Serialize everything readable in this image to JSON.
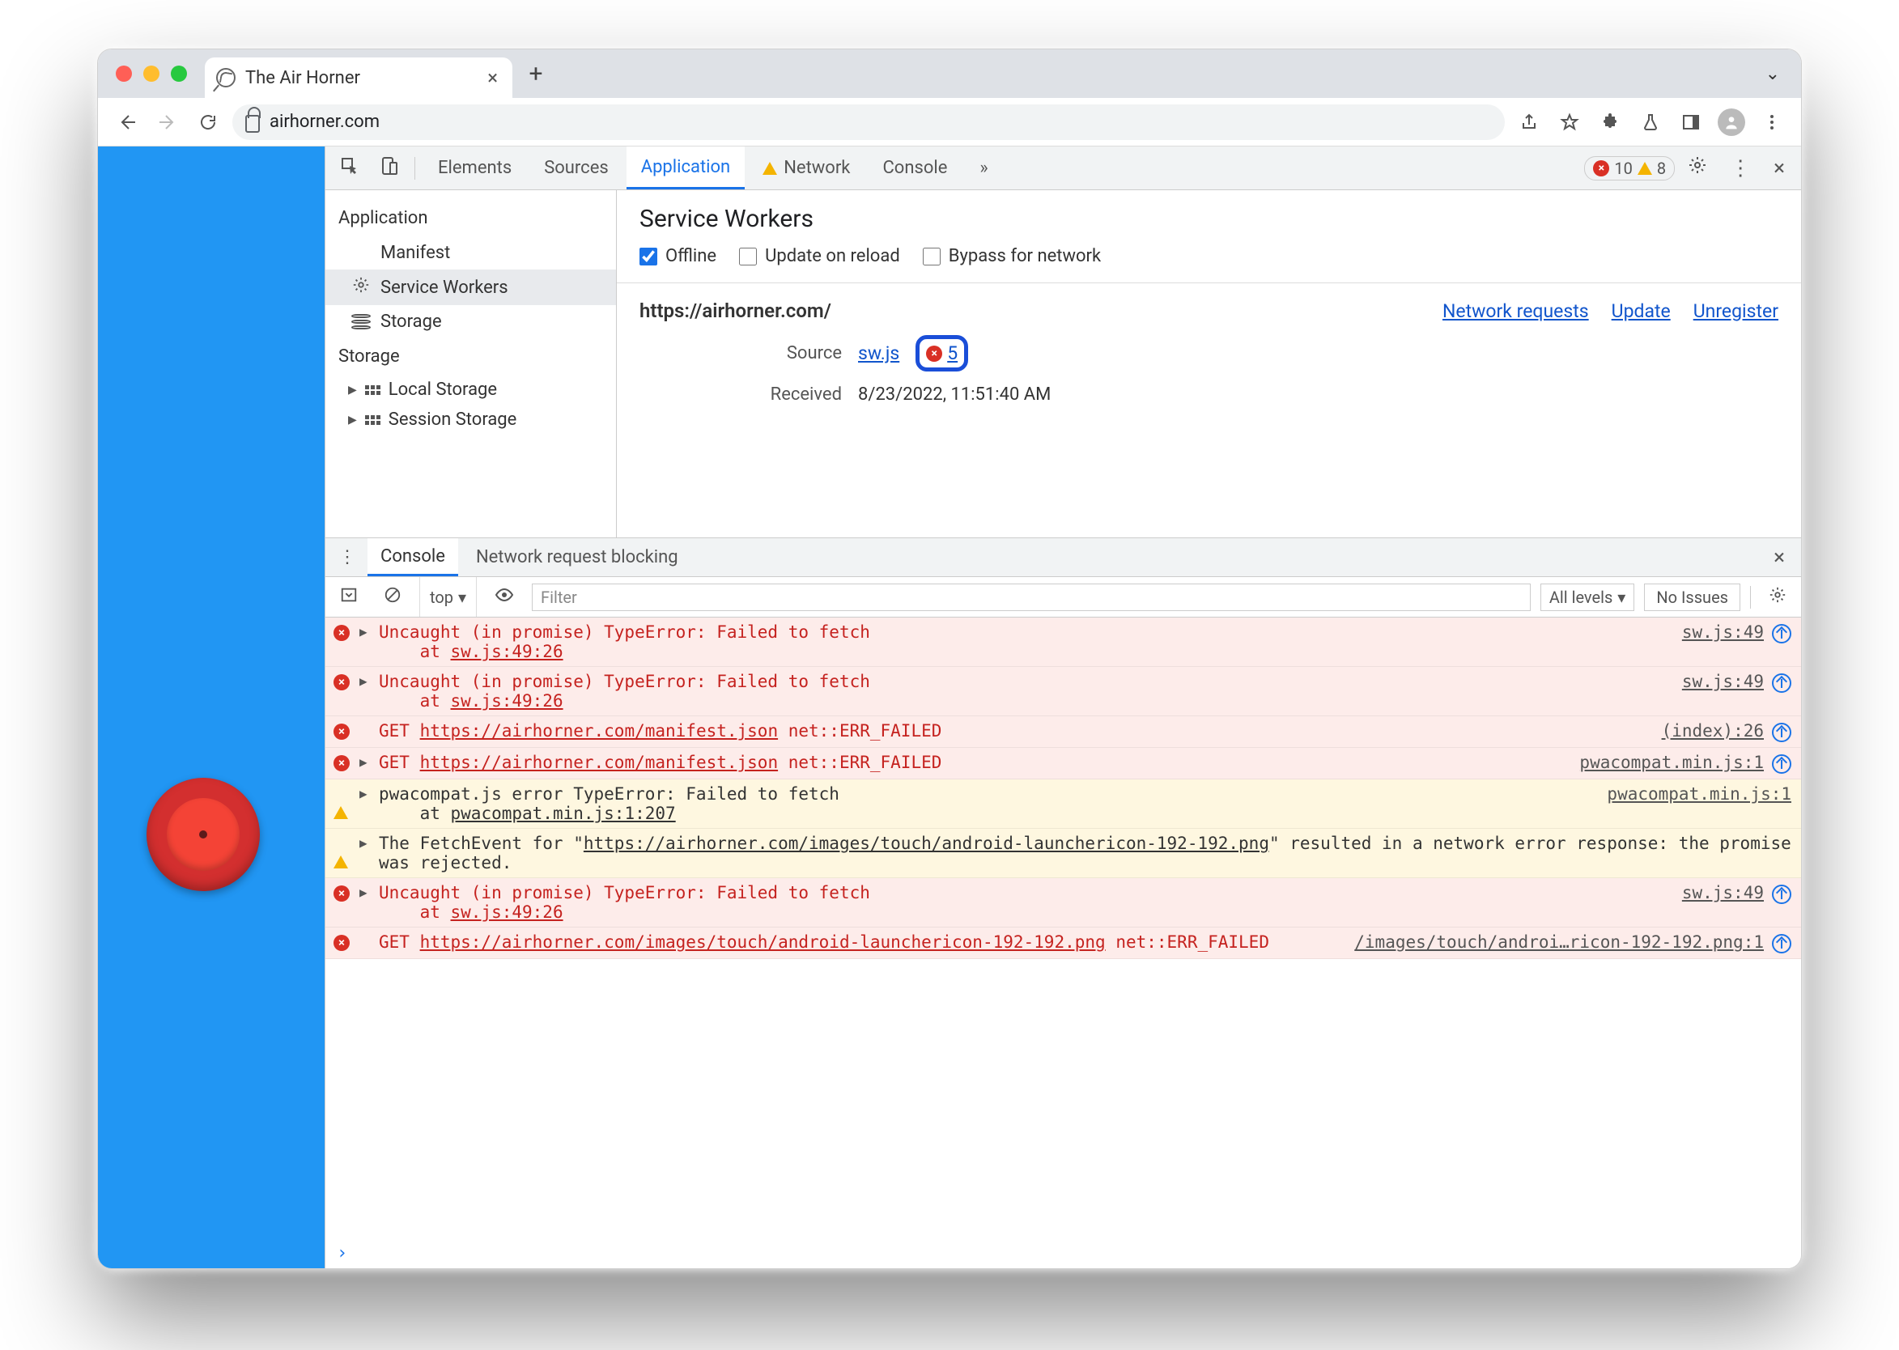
{
  "tab": {
    "title": "The Air Horner"
  },
  "url": "airhorner.com",
  "devtools": {
    "tabs": [
      "Elements",
      "Sources",
      "Application",
      "Network",
      "Console"
    ],
    "errors": "10",
    "warnings": "8"
  },
  "app": {
    "sidebar": {
      "h1": "Application",
      "items": [
        "Manifest",
        "Service Workers",
        "Storage"
      ],
      "h2": "Storage",
      "storage": [
        "Local Storage",
        "Session Storage"
      ]
    },
    "sw": {
      "title": "Service Workers",
      "checks": [
        "Offline",
        "Update on reload",
        "Bypass for network"
      ],
      "origin": "https://airhorner.com/",
      "links": [
        "Network requests",
        "Update",
        "Unregister"
      ],
      "source_label": "Source",
      "source_file": "sw.js",
      "error_count": "5",
      "received_label": "Received",
      "received": "8/23/2022, 11:51:40 AM"
    }
  },
  "drawer": {
    "tabs": [
      "Console",
      "Network request blocking"
    ]
  },
  "console": {
    "context": "top",
    "filter_placeholder": "Filter",
    "levels": "All levels",
    "issues": "No Issues",
    "rows": [
      {
        "type": "err",
        "caret": true,
        "msg": "Uncaught (in promise) TypeError: Failed to fetch\n    at ",
        "link": "sw.js:49:26",
        "loc": "sw.js:49",
        "nav": true
      },
      {
        "type": "err",
        "caret": true,
        "msg": "Uncaught (in promise) TypeError: Failed to fetch\n    at ",
        "link": "sw.js:49:26",
        "loc": "sw.js:49",
        "nav": true
      },
      {
        "type": "err",
        "caret": false,
        "pre": "GET ",
        "url": "https://airhorner.com/manifest.json",
        "post": " net::ERR_FAILED",
        "loc": "(index):26",
        "nav": true
      },
      {
        "type": "err",
        "caret": true,
        "pre": "GET ",
        "url": "https://airhorner.com/manifest.json",
        "post": " net::ERR_FAILED",
        "loc": "pwacompat.min.js:1",
        "nav": true
      },
      {
        "type": "warn",
        "caret": true,
        "msg": "pwacompat.js error TypeError: Failed to fetch\n    at ",
        "link": "pwacompat.min.js:1:207",
        "loc": "pwacompat.min.js:1",
        "nav": false
      },
      {
        "type": "warn",
        "caret": true,
        "msgparts": [
          "The FetchEvent for \"",
          "https://airhorner.com/images/touch/android-launchericon-192-192.png",
          "\" resulted in a network error response: the promise was rejected."
        ],
        "loc": "",
        "nav": false
      },
      {
        "type": "err",
        "caret": true,
        "msg": "Uncaught (in promise) TypeError: Failed to fetch\n    at ",
        "link": "sw.js:49:26",
        "loc": "sw.js:49",
        "nav": true
      },
      {
        "type": "err",
        "caret": false,
        "pre": "GET ",
        "url": "https://airhorner.com/images/touch/android-launchericon-192-192.png",
        "post": " net::ERR_FAILED",
        "loc": "/images/touch/androi…ricon-192-192.png:1",
        "nav": true
      }
    ]
  }
}
